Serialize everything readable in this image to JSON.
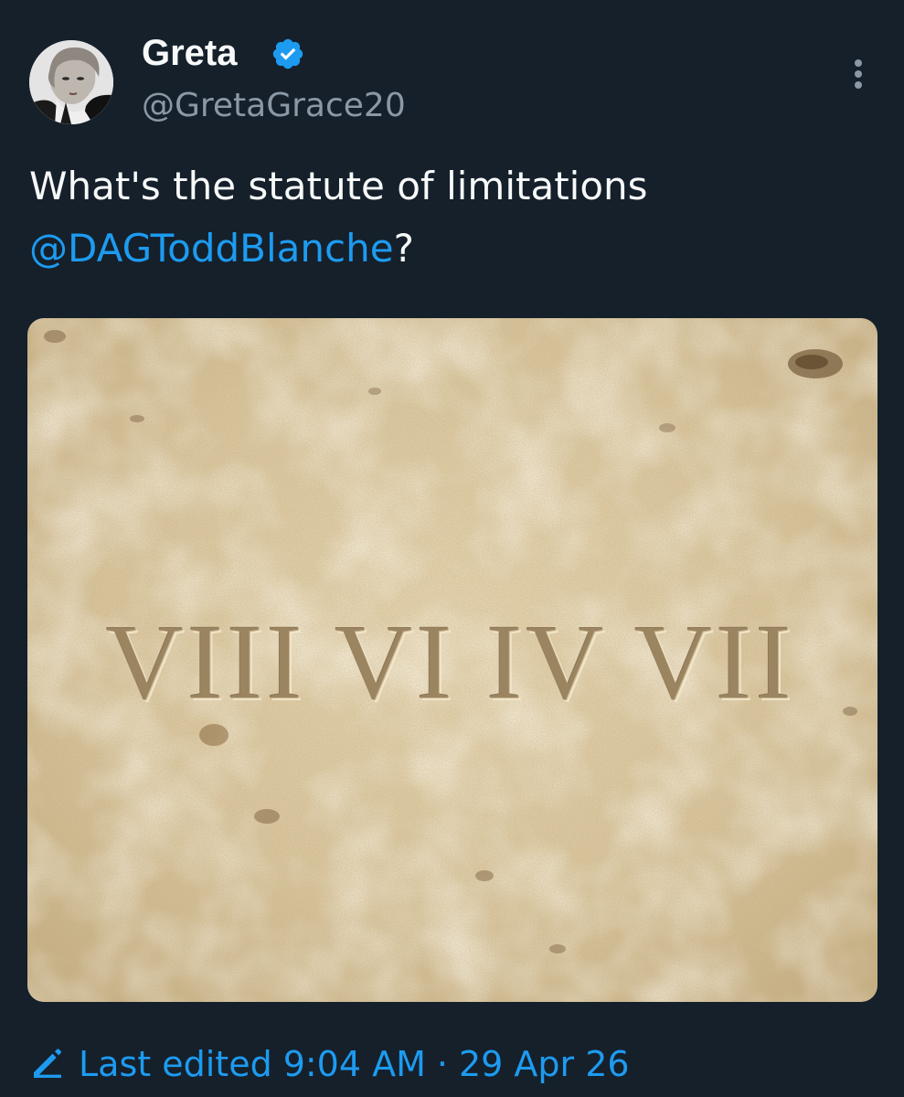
{
  "author": {
    "display_name": "Greta",
    "handle": "@GretaGrace20",
    "verified": true,
    "avatar_icon": "profile-photo"
  },
  "tweet": {
    "text_before": "What's the statute of limitations ",
    "mention": "@DAGToddBlanche",
    "text_after": "?"
  },
  "media": {
    "engraving": "VIII VI IV VII",
    "icon": "stone-tablet-image"
  },
  "edited": {
    "label": "Last edited",
    "time": "9:04 AM",
    "separator": "·",
    "date": "29 Apr 26"
  },
  "colors": {
    "background": "#15202b",
    "accent": "#1d9bf0",
    "secondary_text": "#8b98a5",
    "primary_text": "#f7f9f9"
  }
}
